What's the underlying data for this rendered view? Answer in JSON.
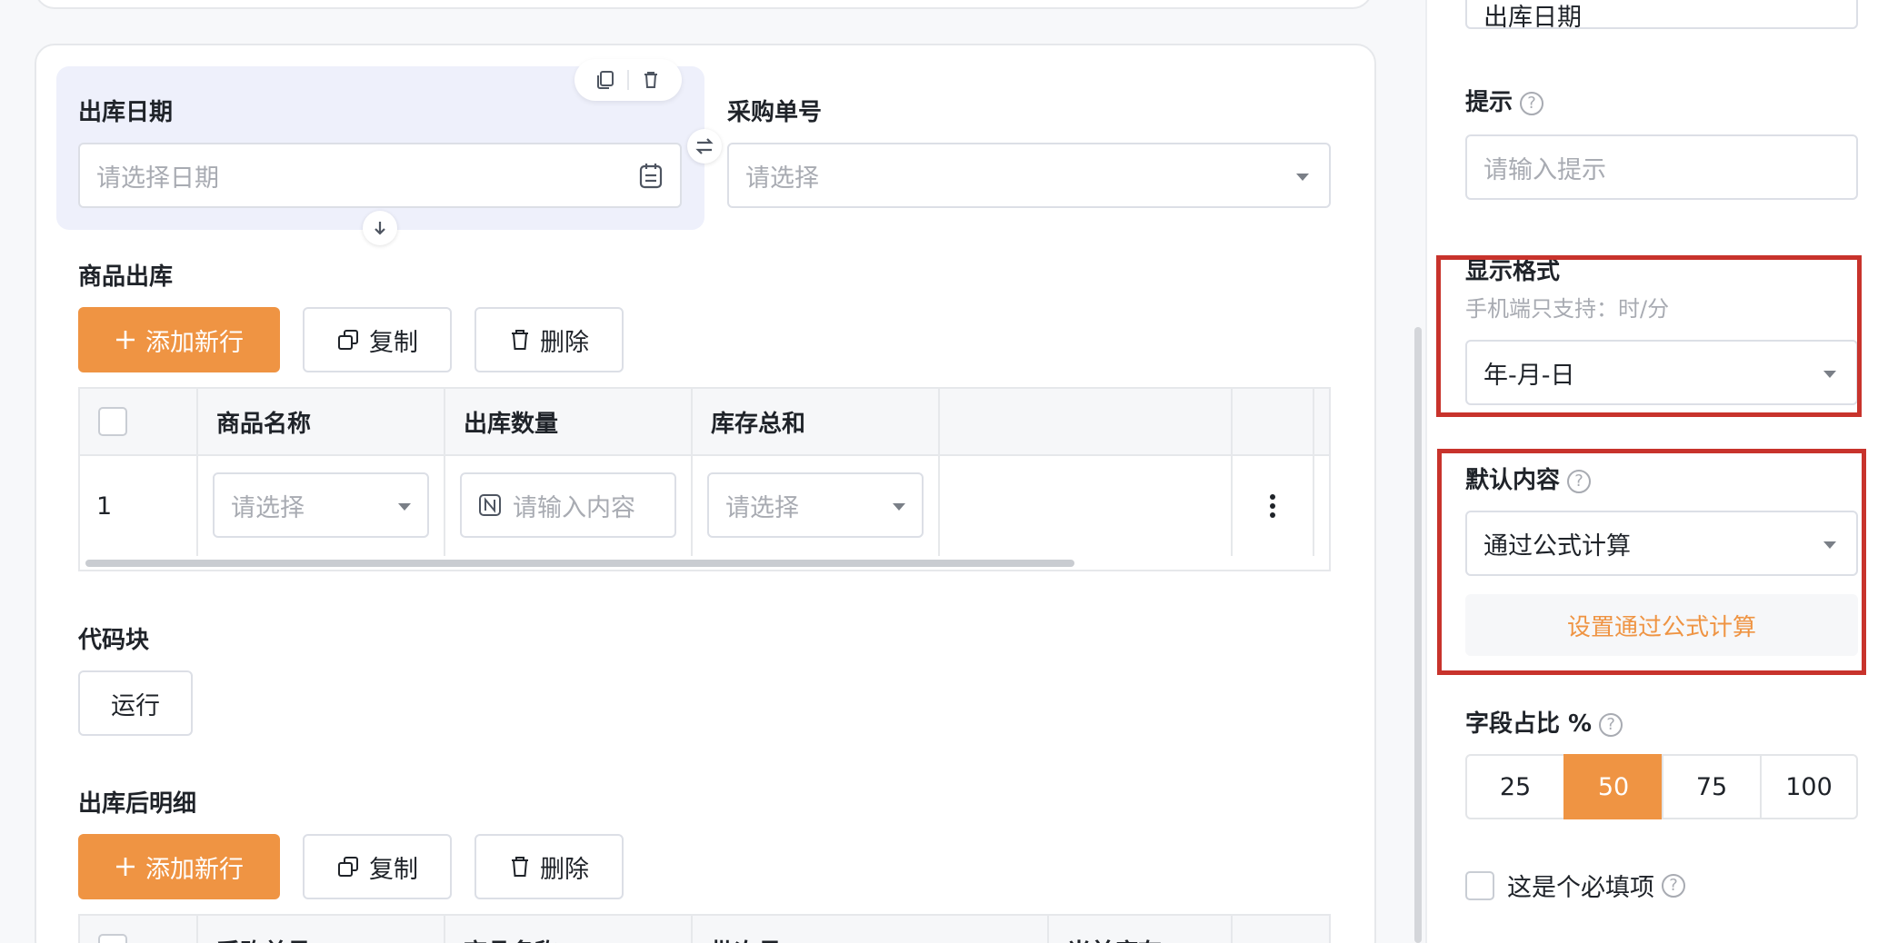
{
  "top_field_value": "出库日期",
  "fields": {
    "outbound_date": {
      "label": "出库日期",
      "placeholder": "请选择日期"
    },
    "purchase_no": {
      "label": "采购单号",
      "placeholder": "请选择"
    }
  },
  "goods_out": {
    "title": "商品出库",
    "add_row": "添加新行",
    "copy": "复制",
    "delete": "删除",
    "columns": [
      "商品名称",
      "出库数量",
      "库存总和"
    ],
    "row_index": "1",
    "cell_placeholders": {
      "name": "请选择",
      "qty": "请输入内容",
      "stock": "请选择"
    }
  },
  "code_block": {
    "title": "代码块",
    "run": "运行"
  },
  "detail": {
    "title": "出库后明细",
    "add_row": "添加新行",
    "copy": "复制",
    "delete": "删除",
    "columns": [
      "采购单号",
      "商品名称",
      "批次号",
      "当前库存"
    ]
  },
  "panel": {
    "hint_label": "提示",
    "hint_placeholder": "请输入提示",
    "format_label": "显示格式",
    "format_note": "手机端只支持：时/分",
    "format_value": "年-月-日",
    "default_label": "默认内容",
    "default_value": "通过公式计算",
    "formula_link": "设置通过公式计算",
    "ratio_label": "字段占比 %",
    "ratio_options": [
      "25",
      "50",
      "75",
      "100"
    ],
    "ratio_selected": "50",
    "required_label": "这是个必填项"
  },
  "colors": {
    "accent": "#ef9443",
    "highlight_box": "#c8332c"
  }
}
